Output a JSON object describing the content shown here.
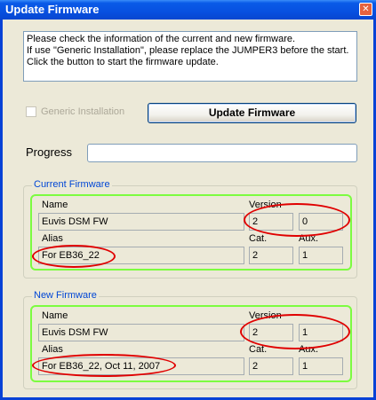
{
  "window": {
    "title": "Update Firmware",
    "close_glyph": "✕"
  },
  "info_lines": [
    "Please check the information of the current and new firmware.",
    "If use \"Generic Installation\", please replace the JUMPER3 before the start.",
    "Click the button to start the firmware update."
  ],
  "generic_installation": {
    "label": "Generic Installation",
    "checked": false,
    "enabled": false
  },
  "update_button": {
    "label": "Update Firmware"
  },
  "progress": {
    "label": "Progress",
    "value": 0
  },
  "current_firmware": {
    "title": "Current Firmware",
    "name_label": "Name",
    "name": "Euvis DSM FW",
    "version_label": "Version",
    "version_major": "2",
    "version_minor": "0",
    "alias_label": "Alias",
    "alias": "For EB36_22",
    "cat_label": "Cat.",
    "cat": "2",
    "aux_label": "Aux.",
    "aux": "1"
  },
  "new_firmware": {
    "title": "New Firmware",
    "name_label": "Name",
    "name": "Euvis DSM FW",
    "version_label": "Version",
    "version_major": "2",
    "version_minor": "1",
    "alias_label": "Alias",
    "alias": "For EB36_22, Oct 11, 2007",
    "cat_label": "Cat.",
    "cat": "2",
    "aux_label": "Aux.",
    "aux": "1"
  },
  "annotation_colors": {
    "highlight_box": "#7CFC40",
    "ellipse": "#E00000"
  }
}
